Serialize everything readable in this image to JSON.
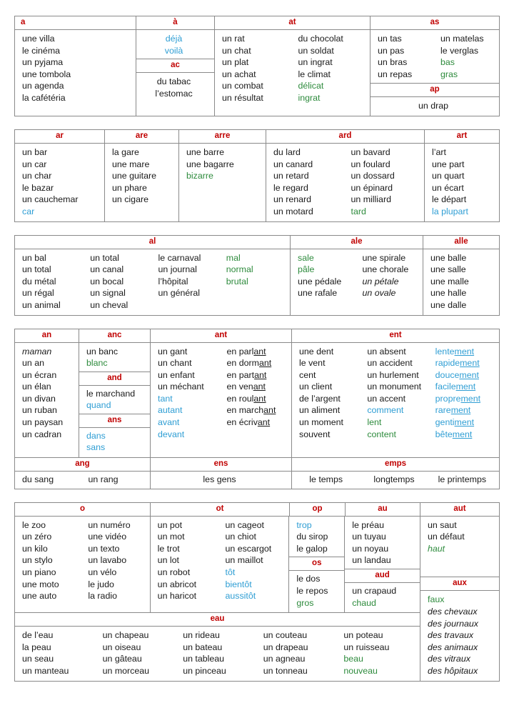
{
  "colors": {
    "header": "#c00000",
    "blue": "#2f9ed4",
    "green": "#2e8b3d",
    "text": "#1a1a1a",
    "border": "#8a8a8a"
  },
  "blocks": [
    {
      "id": "block-a",
      "headers": [
        "a",
        "à",
        "at",
        "as"
      ],
      "groups": {
        "a": [
          "une villa",
          "le cinéma",
          "un pyjama",
          "une tombola",
          "un agenda",
          "la cafétéria"
        ],
        "a_grave": [
          "déjà",
          "voilà"
        ],
        "ac_header": "ac",
        "ac": [
          "du tabac",
          "l’estomac"
        ],
        "at_c1": [
          "un rat",
          "un chat",
          "un plat",
          "un achat",
          "un combat",
          "un résultat"
        ],
        "at_c2": [
          "du chocolat",
          "un soldat",
          "un ingrat",
          "le climat",
          "délicat",
          "ingrat"
        ],
        "as_c1": [
          "un tas",
          "un pas",
          "un bras",
          "un repas"
        ],
        "as_c2": [
          "un matelas",
          "le verglas",
          "bas",
          "gras"
        ],
        "ap_header": "ap",
        "ap": [
          "un drap"
        ]
      }
    },
    {
      "id": "block-ar",
      "headers": [
        "ar",
        "are",
        "arre",
        "ard",
        "art"
      ],
      "groups": {
        "ar": [
          "un bar",
          "un car",
          "un char",
          "le bazar",
          "un cauchemar",
          "car"
        ],
        "are": [
          "la gare",
          "une mare",
          "une guitare",
          "un phare",
          "un cigare"
        ],
        "arre": [
          "une barre",
          "une bagarre",
          "bizarre"
        ],
        "ard_c1": [
          "du lard",
          "un canard",
          "un retard",
          "le regard",
          "un renard",
          "un motard"
        ],
        "ard_c2": [
          "un bavard",
          "un foulard",
          "un dossard",
          "un épinard",
          "un milliard",
          "tard"
        ],
        "art": [
          "l’art",
          "une part",
          "un quart",
          "un écart",
          "le départ",
          "la plupart"
        ]
      }
    },
    {
      "id": "block-al",
      "headers": [
        "al",
        "ale",
        "alle"
      ],
      "groups": {
        "al_c1": [
          "un bal",
          "un total",
          "du métal",
          "un régal",
          "un animal"
        ],
        "al_c2": [
          "un total",
          "un canal",
          "un bocal",
          "un signal",
          "un cheval"
        ],
        "al_c3": [
          "le carnaval",
          "un journal",
          "l’hôpital",
          "un général"
        ],
        "al_c4": [
          "mal",
          "normal",
          "brutal"
        ],
        "ale_c1": [
          "sale",
          "pâle",
          "une pédale",
          "une rafale"
        ],
        "ale_c2": [
          "une spirale",
          "une chorale",
          "un pétale",
          "un ovale"
        ],
        "alle": [
          "une balle",
          "une salle",
          "une malle",
          "une halle",
          "une dalle"
        ]
      }
    },
    {
      "id": "block-an",
      "headers": [
        "an",
        "anc",
        "ant",
        "ent"
      ],
      "headers2": [
        "ang",
        "ens",
        "emps"
      ],
      "groups": {
        "an": [
          "maman",
          "un an",
          "un écran",
          "un élan",
          "un divan",
          "un ruban",
          "un paysan",
          "un cadran"
        ],
        "anc": [
          "un banc",
          "blanc"
        ],
        "and_header": "and",
        "and": [
          "le marchand",
          "quand"
        ],
        "ans_header": "ans",
        "ans": [
          "dans",
          "sans"
        ],
        "ant_c1": [
          "un gant",
          "un chant",
          "un enfant",
          "un méchant",
          "tant",
          "autant",
          "avant",
          "devant"
        ],
        "ant_c2": [
          "en parlant",
          "en dormant",
          "en partant",
          "en venant",
          "en roulant",
          "en marchant",
          "en écrivant"
        ],
        "ent_c1": [
          "une dent",
          "le vent",
          "cent",
          "un client",
          "de l’argent",
          "un aliment",
          "un moment",
          "souvent"
        ],
        "ent_c2": [
          "un absent",
          "un accident",
          "un hurlement",
          "un monument",
          "un accent",
          "comment",
          "lent",
          "content"
        ],
        "ent_c3": [
          "lentement",
          "rapidement",
          "doucement",
          "facilement",
          "proprement",
          "rarement",
          "gentiment",
          "bêtement"
        ],
        "ang_c1": [
          "du sang"
        ],
        "ang_c2": [
          "un rang"
        ],
        "ens": [
          "les gens"
        ],
        "emps_c1": [
          "le temps"
        ],
        "emps_c2": [
          "longtemps"
        ],
        "emps_c3": [
          "le printemps"
        ]
      }
    },
    {
      "id": "block-o",
      "headers": [
        "o",
        "ot",
        "op",
        "au",
        "aut"
      ],
      "headers2": [
        "os",
        "aud",
        "aux",
        "eau"
      ],
      "groups": {
        "o_c1": [
          "le zoo",
          "un zéro",
          "un kilo",
          "un stylo",
          "un piano",
          "une moto",
          "une auto"
        ],
        "o_c2": [
          "un numéro",
          "une vidéo",
          "un texto",
          "un lavabo",
          "un vélo",
          "le judo",
          "la radio"
        ],
        "ot_c1": [
          "un pot",
          "un mot",
          "le trot",
          "un lot",
          "un robot",
          "un abricot",
          "un haricot"
        ],
        "ot_c2": [
          "un cageot",
          "un chiot",
          "un escargot",
          "un maillot",
          "tôt",
          "bientôt",
          "aussitôt"
        ],
        "op": [
          "trop",
          "du sirop",
          "le galop"
        ],
        "os_header": "os",
        "os": [
          "le dos",
          "le repos",
          "gros"
        ],
        "au": [
          "le préau",
          "un tuyau",
          "un noyau",
          "un landau"
        ],
        "aud_header": "aud",
        "aud": [
          "un crapaud",
          "chaud"
        ],
        "aut": [
          "un saut",
          "un défaut",
          "haut"
        ],
        "aux_header": "aux",
        "aux": [
          "faux",
          "des chevaux",
          "des journaux",
          "des travaux",
          "des animaux",
          "des vitraux",
          "des hôpitaux"
        ],
        "eau_header": "eau",
        "eau_c1": [
          "de l’eau",
          "la peau",
          "un seau",
          "un manteau"
        ],
        "eau_c2": [
          "un chapeau",
          "un oiseau",
          "un gâteau",
          "un morceau"
        ],
        "eau_c3": [
          "un rideau",
          "un bateau",
          "un tableau",
          "un pinceau"
        ],
        "eau_c4": [
          "un couteau",
          "un drapeau",
          "un agneau",
          "un tonneau"
        ],
        "eau_c5": [
          "un poteau",
          "un ruisseau",
          "beau",
          "nouveau"
        ]
      }
    }
  ],
  "styles": {
    "blue_words": [
      "déjà",
      "voilà",
      "car",
      "la plupart",
      "quand",
      "dans",
      "sans",
      "tant",
      "autant",
      "avant",
      "devant",
      "comment",
      "lentement",
      "rapidement",
      "doucement",
      "facilement",
      "proprement",
      "rarement",
      "gentiment",
      "bêtement",
      "tôt",
      "bientôt",
      "aussitôt",
      "trop"
    ],
    "green_words": [
      "délicat",
      "ingrat",
      "bas",
      "gras",
      "bizarre",
      "tard",
      "mal",
      "normal",
      "brutal",
      "sale",
      "pâle",
      "blanc",
      "lent",
      "content",
      "gros",
      "chaud",
      "haut",
      "faux",
      "beau",
      "nouveau"
    ],
    "italic_words": [
      "un pétale",
      "un ovale",
      "maman",
      "haut",
      "des chevaux",
      "des journaux",
      "des travaux",
      "des animaux",
      "des vitraux",
      "des hôpitaux"
    ],
    "underline_suffix": {
      "ant": [
        "en parlant",
        "en dormant",
        "en partant",
        "en venant",
        "en roulant",
        "en marchant",
        "en écrivant"
      ],
      "ment": [
        "lentement",
        "rapidement",
        "doucement",
        "facilement",
        "proprement",
        "rarement",
        "gentiment",
        "bêtement"
      ]
    }
  }
}
